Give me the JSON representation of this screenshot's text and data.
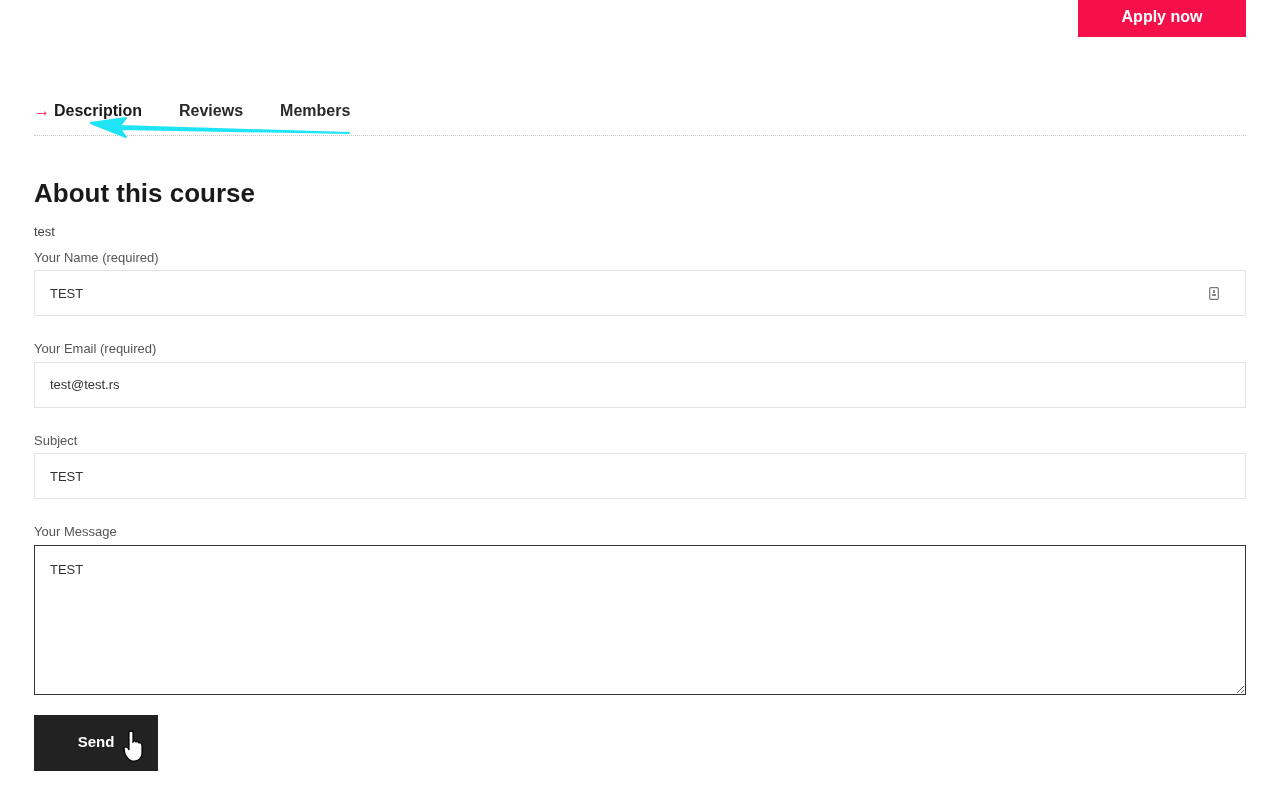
{
  "apply_button": "Apply now",
  "active_marker": "→",
  "tabs": [
    {
      "label": "Description",
      "selected": true
    },
    {
      "label": "Reviews",
      "selected": false
    },
    {
      "label": "Members",
      "selected": false
    }
  ],
  "heading": "About this course",
  "intro": "test",
  "form": {
    "fields": [
      {
        "kind": "text",
        "label": "Your Name (required)",
        "value": "TEST",
        "autofill_icon": true
      },
      {
        "kind": "text",
        "label": "Your Email (required)",
        "value": "test@test.rs"
      },
      {
        "kind": "text",
        "label": "Subject",
        "value": "TEST"
      },
      {
        "kind": "textarea",
        "label": "Your Message",
        "value": "TEST",
        "focused": true
      }
    ],
    "submit": "Send"
  }
}
